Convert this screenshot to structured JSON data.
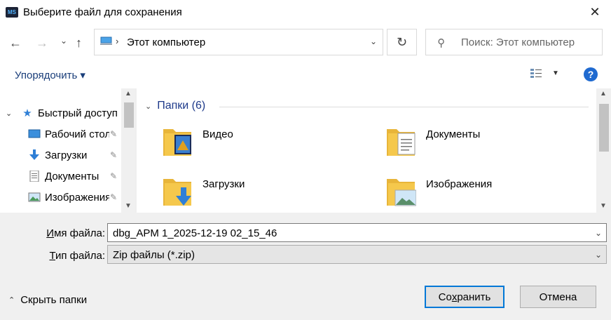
{
  "window": {
    "title": "Выберите файл для сохранения",
    "app_icon_text": "MS",
    "close_glyph": "✕"
  },
  "nav": {
    "back_glyph": "←",
    "forward_glyph": "→",
    "recent_glyph": "⌄",
    "up_glyph": "↑",
    "address_separator": "›",
    "address_text": "Этот компьютер",
    "address_dropdown_glyph": "⌄",
    "refresh_glyph": "↻",
    "search_glyph": "⚲",
    "search_placeholder": "Поиск: Этот компьютер"
  },
  "toolbar": {
    "organize_label": "Упорядочить ▾",
    "view_dropdown_glyph": "▼",
    "help_label": "?"
  },
  "sidebar": {
    "quick_access": "Быстрый доступ",
    "items": [
      {
        "label": "Рабочий стол",
        "icon": "desktop-icon"
      },
      {
        "label": "Загрузки",
        "icon": "downloads-icon"
      },
      {
        "label": "Документы",
        "icon": "documents-icon"
      },
      {
        "label": "Изображения",
        "icon": "pictures-icon"
      }
    ],
    "pin_glyph": "📌"
  },
  "content": {
    "group_title": "Папки (6)",
    "folders": [
      {
        "label": "Видео",
        "icon": "videos-folder-icon"
      },
      {
        "label": "Документы",
        "icon": "documents-folder-icon"
      },
      {
        "label": "Загрузки",
        "icon": "downloads-folder-icon"
      },
      {
        "label": "Изображения",
        "icon": "pictures-folder-icon"
      }
    ]
  },
  "form": {
    "filename_label_pre": "",
    "filename_label_u": "И",
    "filename_label_post": "мя файла:",
    "filename_value": "dbg_APM 1_2025-12-19 02_15_46",
    "filetype_label_u": "Т",
    "filetype_label_post": "ип файла:",
    "filetype_value": "Zip файлы (*.zip)"
  },
  "footer": {
    "hide_folders": "Скрыть папки",
    "save_u": "х",
    "save_pre": "Со",
    "save_post": "ранить",
    "cancel": "Отмена"
  },
  "colors": {
    "accent": "#0078d7",
    "link_blue": "#1e3a8a",
    "help_blue": "#1f6ad0",
    "folder_yellow": "#f5c84c"
  }
}
